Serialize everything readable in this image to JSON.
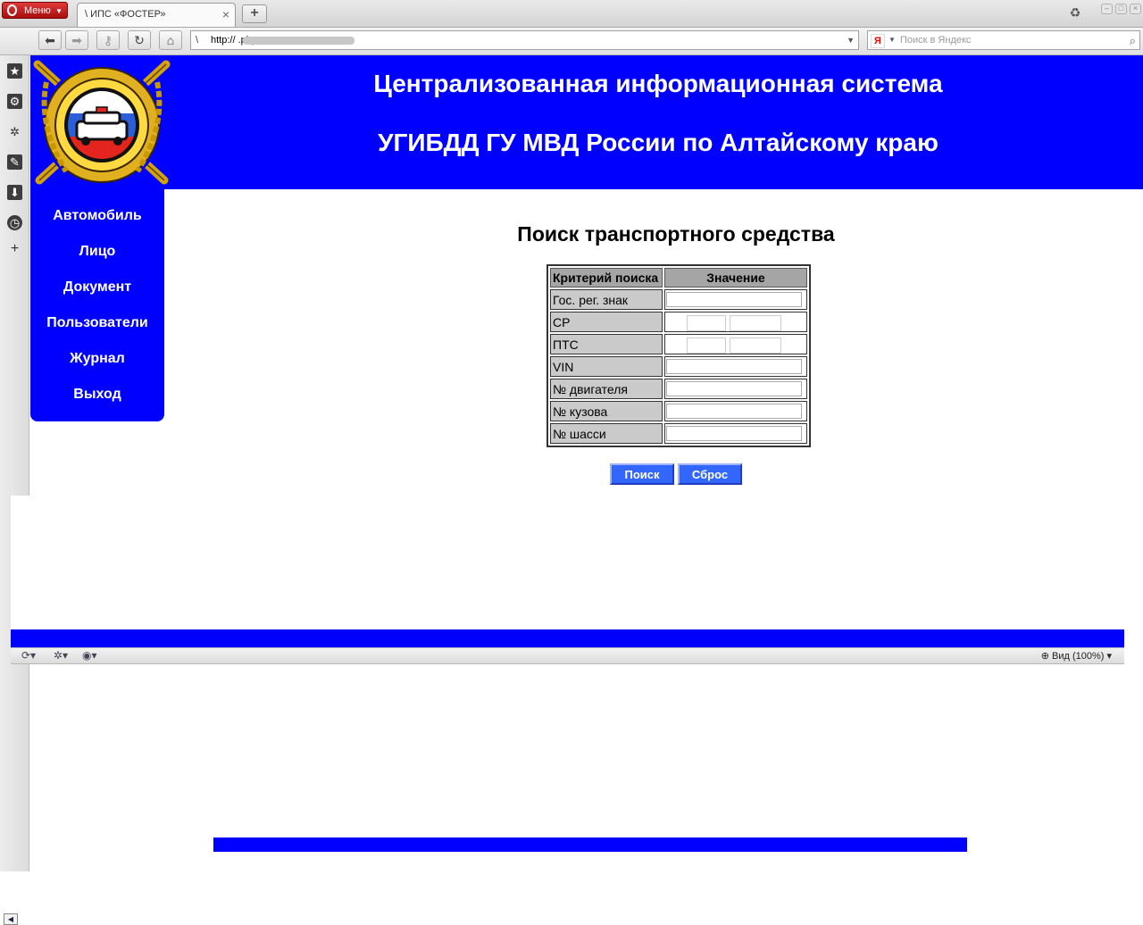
{
  "browser": {
    "menu_label": "Меню",
    "tab_title": "\\ ИПС «ФОСТЕР»",
    "url": "http://                                   .php",
    "search_placeholder": "Поиск в Яндекс",
    "zoom_label": "Вид (100%)"
  },
  "header": {
    "line1": "Централизованная информационная система",
    "line2": "УГИБДД ГУ МВД России по Алтайскому краю"
  },
  "menu": {
    "items": [
      {
        "label": "Автомобиль"
      },
      {
        "label": "Лицо"
      },
      {
        "label": "Документ"
      },
      {
        "label": "Пользователи"
      },
      {
        "label": "Журнал"
      },
      {
        "label": "Выход"
      }
    ]
  },
  "form": {
    "title": "Поиск транспортного средства",
    "col_criteria": "Критерий поиска",
    "col_value": "Значение",
    "rows": [
      {
        "label": "Гос. рег. знак",
        "value": ""
      },
      {
        "label": "СР",
        "series": "",
        "number": ""
      },
      {
        "label": "ПТС",
        "series": "",
        "number": ""
      },
      {
        "label": "VIN",
        "value": ""
      },
      {
        "label": "№ двигателя",
        "value": ""
      },
      {
        "label": "№ кузова",
        "value": ""
      },
      {
        "label": "№ шасси",
        "value": ""
      }
    ],
    "search_button": "Поиск",
    "reset_button": "Сброс"
  },
  "colors": {
    "brand_blue": "#0000ff",
    "button_blue": "#3366ff"
  }
}
